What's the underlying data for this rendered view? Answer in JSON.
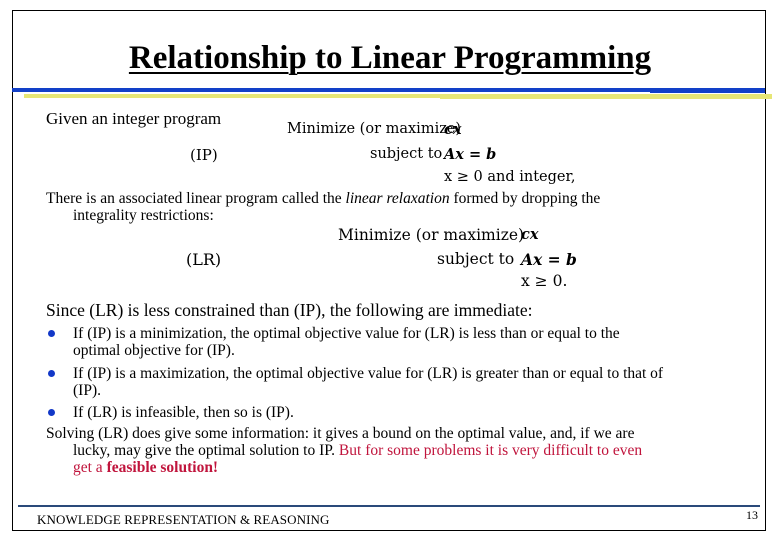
{
  "title": "Relationship to Linear Programming",
  "intro": "Given an integer program",
  "ip": {
    "label": "(IP)",
    "objective_label": "Minimize (or maximize)",
    "objective_expr": "cx",
    "subject_label": "subject to",
    "constraint1": "Ax = b",
    "constraint2": "x ≥ 0 and integer,"
  },
  "relaxation_text": {
    "line1_a": "There is an associated linear program called the ",
    "line1_italic": "linear relaxation",
    "line1_b": " formed by dropping the",
    "line2": "integrality restrictions:"
  },
  "lr": {
    "label": "(LR)",
    "objective_label": "Minimize (or maximize)",
    "objective_expr": "cx",
    "subject_label": "subject to",
    "constraint1": "Ax = b",
    "constraint2": "x ≥ 0."
  },
  "since_text": "Since (LR) is less constrained than (IP), the following are immediate:",
  "bullets": [
    {
      "line1": "If (IP) is a minimization, the optimal objective value for (LR) is less than or equal to the",
      "line2": "optimal objective for (IP)."
    },
    {
      "line1": "If (IP) is a maximization, the optimal objective value for (LR) is greater than or equal to that of",
      "line2": "(IP)."
    },
    {
      "line1": "If (LR) is infeasible, then so is (IP).",
      "line2": ""
    }
  ],
  "solving": {
    "line1": "Solving (LR) does give some information: it gives a bound on the optimal value, and, if we are",
    "line2_black": "lucky, may give the optimal solution to IP. ",
    "line2_red": "But for some problems it is very difficult to even",
    "line3_red": "get a ",
    "line3_red_bold": "feasible solution!"
  },
  "footer": {
    "label": "KNOWLEDGE REPRESENTATION & REASONING",
    "page_number": "13"
  },
  "colors": {
    "rule_blue": "#1240c8",
    "rule_yellow": "#e6e676",
    "emphasis_red": "#c0143c",
    "footer_rule": "#2a4a7a"
  }
}
